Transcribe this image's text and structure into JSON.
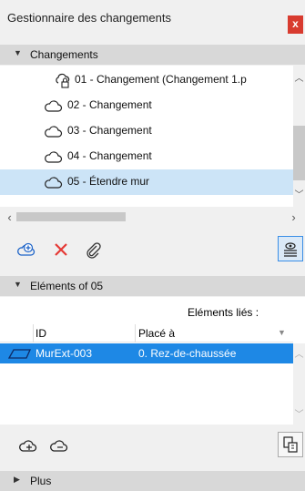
{
  "window": {
    "title": "Gestionnaire des changements",
    "close_glyph": "x"
  },
  "changes_section": {
    "label": "Changements",
    "items": [
      {
        "label": "01 - Changement (Changement 1.p",
        "icon": "locked-cloud-icon"
      },
      {
        "label": "02 - Changement",
        "icon": "cloud-icon"
      },
      {
        "label": "03 - Changement",
        "icon": "cloud-icon"
      },
      {
        "label": "04 - Changement",
        "icon": "cloud-icon"
      },
      {
        "label": "05 - Étendre mur",
        "icon": "cloud-icon",
        "selected": true
      }
    ]
  },
  "elements_section": {
    "label": "Eléments of 05",
    "linked_label": "Eléments liés :",
    "columns": [
      "ID",
      "Placé à"
    ],
    "rows": [
      {
        "id": "MurExt-003",
        "placed": "0. Rez-de-chaussée",
        "selected": true
      }
    ]
  },
  "more_section": {
    "label": "Plus"
  },
  "colors": {
    "selection_light": "#cce4f7",
    "selection_dark": "#1e88e5",
    "close": "#d83b2f",
    "delete": "#e53935"
  }
}
